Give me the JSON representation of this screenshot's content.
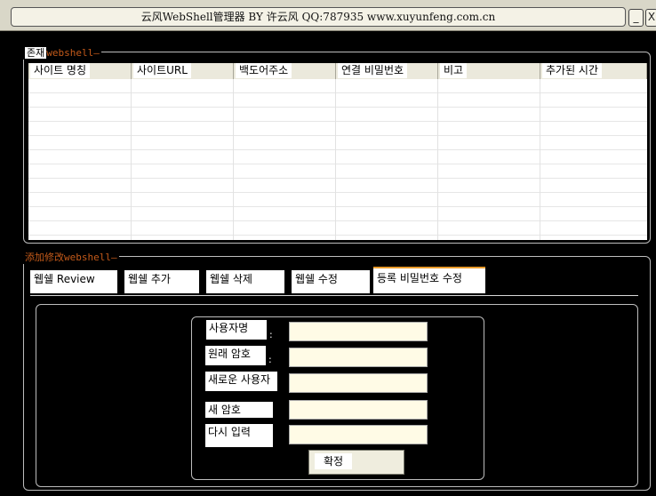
{
  "window": {
    "title": "云风WebShell管理器 BY 许云风 QQ:787935 www.xuyunfeng.com.cn",
    "min_label": "_",
    "close_label": "X"
  },
  "list_group": {
    "legend_highlight": "존재",
    "legend_rest": "webshell—",
    "columns": [
      "사이트 명칭",
      "사이트URL",
      "백도어주소",
      "연결 비밀번호",
      "비고",
      "추가된 시간"
    ],
    "rows": []
  },
  "edit_group": {
    "legend": "添加修改webshell—",
    "tabs": [
      "웹쉘 Review",
      "웹쉘 추가",
      "웹쉘 삭제",
      "웹쉘 수정",
      "등록 비밀번호 수정"
    ],
    "active_tab_index": 4,
    "form": {
      "username_label": "사용자명",
      "old_password_label": "원래 암호",
      "new_username_label": "새로운 사용자",
      "new_password_label": "새 암호",
      "confirm_label": "다시 입력",
      "username_value": "",
      "old_password_value": "",
      "new_username_value": "",
      "new_password_value": "",
      "confirm_value": "",
      "ok_label": "확정"
    }
  },
  "colors": {
    "legend_accent": "#c45a1a",
    "active_tab_accent": "#e89a2a",
    "input_bg": "#fffbe6"
  }
}
